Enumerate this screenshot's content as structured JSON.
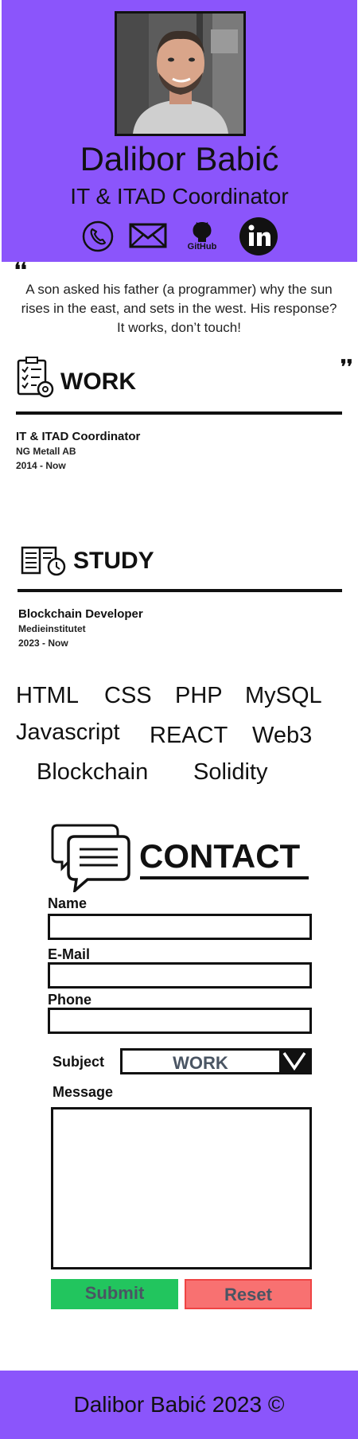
{
  "header": {
    "name": "Dalibor Babić",
    "role": "IT & ITAD Coordinator",
    "social": [
      {
        "icon": "phone-icon"
      },
      {
        "icon": "mail-icon"
      },
      {
        "icon": "github-icon",
        "label": "GitHub"
      },
      {
        "icon": "linkedin-icon"
      }
    ]
  },
  "quote": {
    "open_mark": "❛❛",
    "close_mark": "❜❜",
    "text": "A son asked his father (a programmer) why the sun rises in the east, and sets in the west. His response? It works, don’t touch!"
  },
  "work": {
    "title": "WORK",
    "icon": "clipboard-gear-icon",
    "entry": {
      "role": "IT & ITAD Coordinator",
      "company": "NG Metall AB",
      "period": "2014 - Now"
    }
  },
  "study": {
    "title": "STUDY",
    "icon": "book-clock-icon",
    "entry": {
      "role": "Blockchain Developer",
      "school": "Medieinstitutet",
      "period": "2023 - Now"
    }
  },
  "skills": [
    "HTML",
    "CSS",
    "PHP",
    "MySQL",
    "Javascript",
    "REACT",
    "Web3",
    "Blockchain",
    "Solidity"
  ],
  "contact": {
    "title": "CONTACT",
    "icon": "chat-bubbles-icon",
    "name_label": "Name",
    "email_label": "E-Mail",
    "phone_label": "Phone",
    "subject_label": "Subject",
    "subject_value": "WORK",
    "message_label": "Message",
    "submit_label": "Submit",
    "reset_label": "Reset"
  },
  "footer": {
    "text": "Dalibor Babić 2023 ©"
  },
  "colors": {
    "accent": "#8b55fb",
    "submit": "#22c55e",
    "reset": "#f87171"
  }
}
